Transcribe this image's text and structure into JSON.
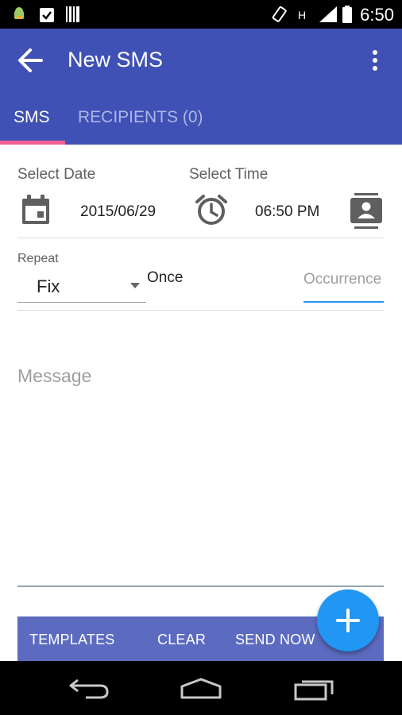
{
  "status_bar": {
    "time": "6:50"
  },
  "toolbar": {
    "title": "New SMS",
    "back_icon": "arrow-left-icon",
    "menu_icon": "more-vert-icon"
  },
  "tabs": [
    {
      "label": "SMS",
      "active": true
    },
    {
      "label": "RECIPIENTS (0)",
      "active": false
    }
  ],
  "schedule": {
    "date_label": "Select Date",
    "date_value": "2015/06/29",
    "time_label": "Select Time",
    "time_value": "06:50 PM"
  },
  "repeat": {
    "label": "Repeat",
    "selected": "Fix",
    "summary": "Once",
    "occurrence_placeholder": "Occurrence"
  },
  "message": {
    "placeholder": "Message"
  },
  "actions": {
    "templates": "TEMPLATES",
    "clear": "CLEAR",
    "send_now": "SEND NOW"
  },
  "colors": {
    "primary": "#3f51b5",
    "action_bar": "#5c6bc0",
    "tab_indicator": "#f06292",
    "fab": "#2196f3",
    "field_underline": "#2196f3"
  }
}
